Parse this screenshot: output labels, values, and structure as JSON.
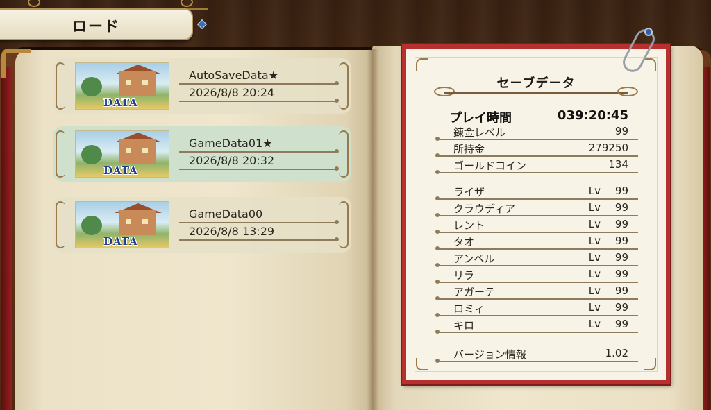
{
  "header": {
    "title": "ロード"
  },
  "slots": [
    {
      "name": "AutoSaveData★",
      "date": "2026/8/8 20:24",
      "thumb_label": "DATA",
      "selected": false
    },
    {
      "name": "GameData01★",
      "date": "2026/8/8 20:32",
      "thumb_label": "DATA",
      "selected": true
    },
    {
      "name": "GameData00",
      "date": "2026/8/8 13:29",
      "thumb_label": "DATA",
      "selected": false
    }
  ],
  "save_info": {
    "title": "セーブデータ",
    "play_time_label": "プレイ時間",
    "play_time": "039:20:45",
    "stats": [
      {
        "label": "錬金レベル",
        "value": "99"
      },
      {
        "label": "所持金",
        "value": "279250"
      },
      {
        "label": "ゴールドコイン",
        "value": "134"
      }
    ],
    "level_prefix": "Lv",
    "party": [
      {
        "name": "ライザ",
        "level": "99"
      },
      {
        "name": "クラウディア",
        "level": "99"
      },
      {
        "name": "レント",
        "level": "99"
      },
      {
        "name": "タオ",
        "level": "99"
      },
      {
        "name": "アンペル",
        "level": "99"
      },
      {
        "name": "リラ",
        "level": "99"
      },
      {
        "name": "アガーテ",
        "level": "99"
      },
      {
        "name": "ロミィ",
        "level": "99"
      },
      {
        "name": "キロ",
        "level": "99"
      }
    ],
    "version_label": "バージョン情報",
    "version": "1.02"
  },
  "colors": {
    "card_border": "#b5302e",
    "selected_slot": "#cfe1cc",
    "data_label": "#1c3c8c"
  },
  "icons": [
    "paperclip-icon",
    "gem-icon",
    "scroll-ornament-icon"
  ]
}
